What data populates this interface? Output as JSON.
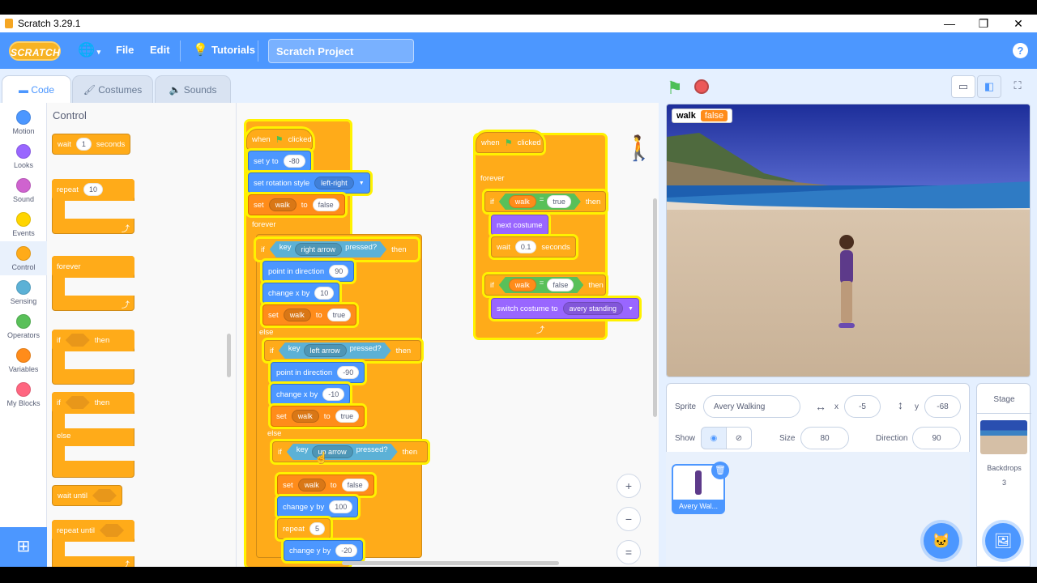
{
  "window": {
    "title": "Scratch 3.29.1",
    "minimize": "—",
    "maximize": "❐",
    "close": "✕"
  },
  "menu": {
    "logo": "SCRATCH",
    "file": "File",
    "edit": "Edit",
    "tutorials": "Tutorials",
    "project_title": "Scratch Project",
    "help": "?"
  },
  "tabs": [
    {
      "label": "Code"
    },
    {
      "label": "Costumes"
    },
    {
      "label": "Sounds"
    }
  ],
  "categories": [
    {
      "label": "Motion",
      "color": "#4c97ff"
    },
    {
      "label": "Looks",
      "color": "#9966ff"
    },
    {
      "label": "Sound",
      "color": "#cf63cf"
    },
    {
      "label": "Events",
      "color": "#ffd500"
    },
    {
      "label": "Control",
      "color": "#ffab19"
    },
    {
      "label": "Sensing",
      "color": "#5cb1d6"
    },
    {
      "label": "Operators",
      "color": "#59c059"
    },
    {
      "label": "Variables",
      "color": "#ff8c1a"
    },
    {
      "label": "My Blocks",
      "color": "#ff6680"
    }
  ],
  "palette": {
    "title": "Control",
    "wait": "wait",
    "wait_val": "1",
    "seconds": "seconds",
    "repeat": "repeat",
    "repeat_val": "10",
    "forever": "forever",
    "if": "if",
    "then": "then",
    "else": "else",
    "wait_until": "wait until",
    "repeat_until": "repeat until"
  },
  "script1": {
    "when": "when",
    "clicked": "clicked",
    "set_y": "set y to",
    "set_y_val": "-80",
    "rot": "set rotation style",
    "rot_val": "left-right",
    "set": "set",
    "walk": "walk",
    "to": "to",
    "false": "false",
    "true": "true",
    "forever": "forever",
    "if": "if",
    "then": "then",
    "else": "else",
    "key": "key",
    "right_arrow": "right arrow",
    "left_arrow": "left arrow",
    "up_arrow": "up arrow",
    "pressed": "pressed?",
    "point": "point in direction",
    "dir90": "90",
    "dirm90": "-90",
    "change_x": "change x by",
    "x10": "10",
    "xm10": "-10",
    "change_y": "change y by",
    "y100": "100",
    "ym20": "-20",
    "repeat": "repeat",
    "rep5": "5"
  },
  "script2": {
    "when": "when",
    "clicked": "clicked",
    "forever": "forever",
    "if": "if",
    "then": "then",
    "walk": "walk",
    "eq": "=",
    "true": "true",
    "false": "false",
    "next_costume": "next costume",
    "wait": "wait",
    "wait_val": "0.1",
    "seconds": "seconds",
    "switch": "switch costume to",
    "costume": "avery standing"
  },
  "zoom": {
    "in": "+",
    "out": "−",
    "reset": "="
  },
  "stage": {
    "monitor_label": "walk",
    "monitor_value": "false"
  },
  "sprite": {
    "sprite_label": "Sprite",
    "name": "Avery Walking",
    "x_label": "x",
    "x": "-5",
    "y_label": "y",
    "y": "-68",
    "show_label": "Show",
    "size_label": "Size",
    "size": "80",
    "direction_label": "Direction",
    "direction": "90",
    "thumb_label": "Avery Wal..."
  },
  "stage_panel": {
    "title": "Stage",
    "backdrops_label": "Backdrops",
    "backdrops_count": "3"
  }
}
